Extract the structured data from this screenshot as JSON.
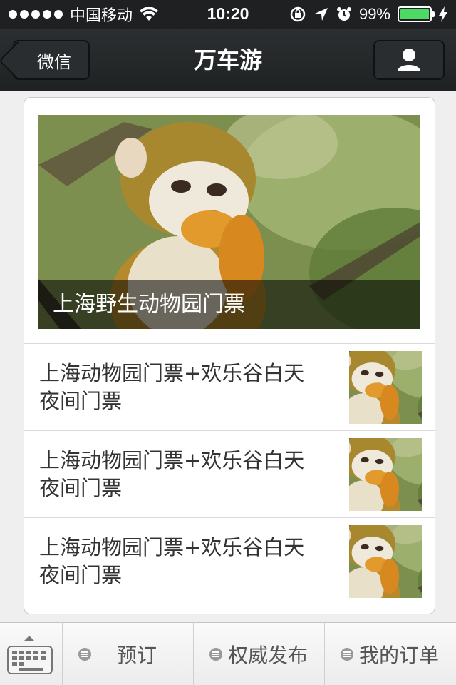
{
  "status_bar": {
    "carrier": "中国移动",
    "time": "10:20",
    "battery": "99%",
    "battery_level": 0.99
  },
  "nav": {
    "back_label": "微信",
    "title": "万车游",
    "profile_icon": "person-icon"
  },
  "hero": {
    "caption": "上海野生动物园门票"
  },
  "articles": [
    {
      "title": "上海动物园门票+欢乐谷白天夜间门票"
    },
    {
      "title": "上海动物园门票+欢乐谷白天夜间门票"
    },
    {
      "title": "上海动物园门票+欢乐谷白天夜间门票"
    }
  ],
  "toolbar": {
    "keyboard_icon": "keyboard-icon",
    "tabs": [
      {
        "label": "预订"
      },
      {
        "label": "权威发布"
      },
      {
        "label": "我的订单"
      }
    ]
  }
}
